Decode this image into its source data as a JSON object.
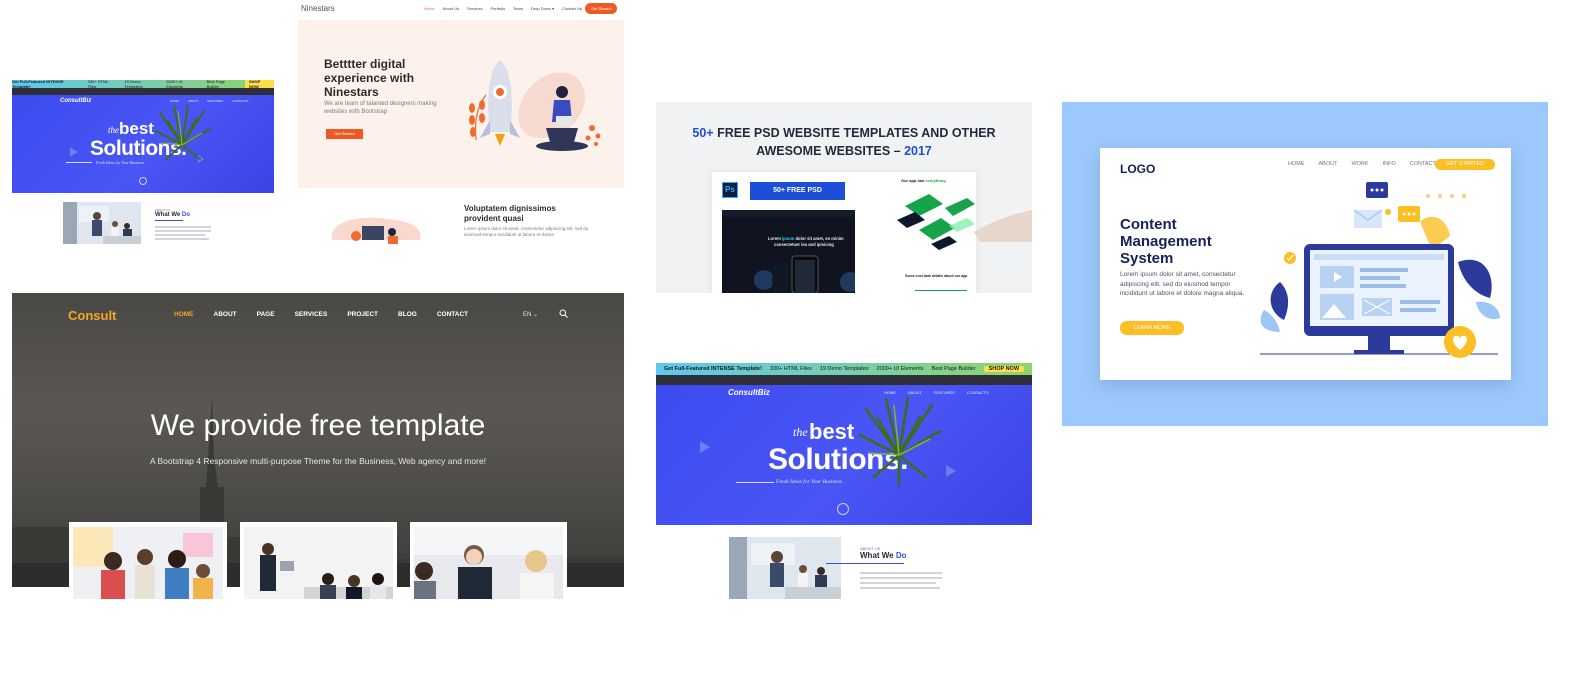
{
  "consultbiz_small": {
    "promo": "Get Full-Featured INTENSE Template!",
    "promo_items": [
      "330+ HTML Files",
      "19 Demo Templates",
      "2000+ UI Elements",
      "Best Page Builder"
    ],
    "promo_button": "SHOP NOW",
    "logo": "ConsultBiz",
    "nav": [
      "HOME",
      "ABOUT",
      "FEATURES",
      "CONTACTS"
    ],
    "hero_the": "the",
    "hero_best": "best",
    "hero_solutions": "Solutions.",
    "hero_sub": "Fresh Ideas for Your Business",
    "section_kicker": "ABOUT US",
    "section_title_a": "What We ",
    "section_title_b": "Do"
  },
  "ninestars": {
    "brand": "Ninestars",
    "nav": [
      "Home",
      "About Us",
      "Services",
      "Portfolio",
      "Team",
      "Drop Down",
      "Contact Us"
    ],
    "cta": "Get Started",
    "hero_title": "Betttter digital experience with Ninestars",
    "hero_text": "We are team of talanted designers making websites with Bootstrap",
    "hero_button": "Get Started",
    "section_title": "Voluptatem dignissimos provident quasi",
    "section_text": "Lorem ipsum dolor sit amet, consectetur adipiscing elit, sed do eiusmod tempor incididunt ut labore et dolore"
  },
  "psd_banner": {
    "title_num": "50+",
    "title_rest": " FREE PSD WEBSITE TEMPLATES AND OTHER",
    "title_line2": "AWESOME WEBSITES – ",
    "title_year": "2017",
    "ps_label": "Ps",
    "badge": "50+ FREE PSD",
    "dark_heading_a": "Lorem ",
    "dark_heading_b": "ipsum",
    "dark_heading_c": " dolor sit amet, en minim",
    "dark_heading_line2": "consectetuer lea and ipisicing",
    "right_heading_a": "Our app has ",
    "right_heading_b": "everything",
    "right_sub": "Some cool dark details about our app"
  },
  "cms": {
    "logo": "LOGO",
    "nav": [
      "HOME",
      "ABOUT",
      "WORK",
      "INFO",
      "CONTACT"
    ],
    "cta": "GET STARTED",
    "title": "Content Management System",
    "text": "Lorem ipsum dolor sit amet, consectetur adipiscing elit, sed do eiusmod tempor incididunt ut labore et dolore magna aliqua.",
    "button": "LEARN MORE",
    "colors": {
      "background": "#9dc8fb",
      "navy": "#17205a",
      "accent": "#fbbf24"
    }
  },
  "consult": {
    "logo": "Consult",
    "nav": [
      "HOME",
      "ABOUT",
      "PAGE",
      "SERVICES",
      "PROJECT",
      "BLOG",
      "CONTACT"
    ],
    "lang": "EN",
    "headline": "We provide free template",
    "subline": "A Bootstrap 4 Responsive multi-purpose Theme for the Business, Web agency and more!",
    "colors": {
      "accent": "#f6a623"
    }
  },
  "consultbiz_large": {
    "promo": "Get Full-Featured INTENSE Template!",
    "promo_items": [
      "330+ HTML Files",
      "19 Demo Templates",
      "2000+ UI Elements",
      "Best Page Builder"
    ],
    "promo_button": "SHOP NOW",
    "logo": "ConsultBiz",
    "nav": [
      "HOME",
      "ABOUT",
      "FEATURES",
      "CONTACTS"
    ],
    "hero_the": "the",
    "hero_best": "best",
    "hero_solutions": "Solutions.",
    "hero_sub": "Fresh Ideas for Your Business",
    "section_kicker": "ABOUT US",
    "section_title_a": "What We ",
    "section_title_b": "Do"
  }
}
